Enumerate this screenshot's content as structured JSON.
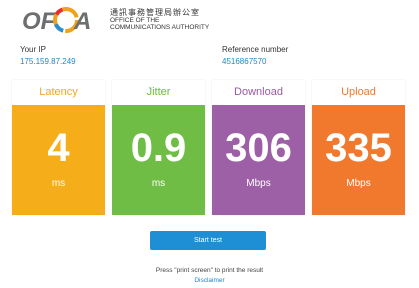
{
  "header": {
    "logo_text": "OFCA",
    "org_name_zh": "通訊事務管理局辦公室",
    "org_name_en_line1": "OFFICE OF THE",
    "org_name_en_line2": "COMMUNICATIONS AUTHORITY"
  },
  "info": {
    "ip_label": "Your IP",
    "ip_value": "175.159.87.249",
    "ref_label": "Reference number",
    "ref_value": "4516867570"
  },
  "metrics": [
    {
      "label": "Latency",
      "value": "4",
      "unit": "ms",
      "color": "#f5ad1a"
    },
    {
      "label": "Jitter",
      "value": "0.9",
      "unit": "ms",
      "color": "#6fbd45"
    },
    {
      "label": "Download",
      "value": "306",
      "unit": "Mbps",
      "color": "#9d5fa5"
    },
    {
      "label": "Upload",
      "value": "335",
      "unit": "Mbps",
      "color": "#f1792e"
    }
  ],
  "actions": {
    "start_label": "Start test",
    "start_color": "#1e8fd4"
  },
  "footer": {
    "note": "Press \"print screen\" to print the result",
    "disclaimer": "Disclaimer"
  }
}
